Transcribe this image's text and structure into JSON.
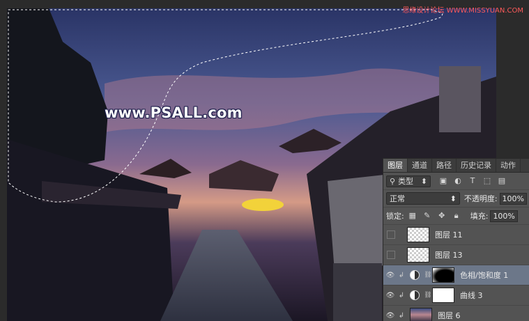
{
  "canvas": {
    "watermark": "www.PSALL.com",
    "site_mark": "思缘设计论坛 WWW.MISSYUAN.COM"
  },
  "layers_panel": {
    "tabs": [
      {
        "label": "图层",
        "active": true
      },
      {
        "label": "通道",
        "active": false
      },
      {
        "label": "路径",
        "active": false
      },
      {
        "label": "历史记录",
        "active": false
      },
      {
        "label": "动作",
        "active": false
      }
    ],
    "filter_kind": "类型",
    "blend_mode": "正常",
    "opacity_label": "不透明度:",
    "opacity_value": "100%",
    "lock_label": "锁定:",
    "fill_label": "填充:",
    "fill_value": "100%",
    "layers": [
      {
        "name": "图层 11",
        "visible": false,
        "thumb": "checker"
      },
      {
        "name": "图层 13",
        "visible": false,
        "thumb": "checker"
      },
      {
        "name": "色相/饱和度 1",
        "visible": true,
        "thumb": "adjustment-mask",
        "selected": true
      },
      {
        "name": "曲线 3",
        "visible": true,
        "thumb": "adjustment-white"
      },
      {
        "name": "图层 6",
        "visible": true,
        "thumb": "photo"
      }
    ]
  },
  "colors": {
    "panel_bg": "#535353",
    "selected_row": "#6c7789",
    "watermark_outline": "#1b1d4a"
  }
}
